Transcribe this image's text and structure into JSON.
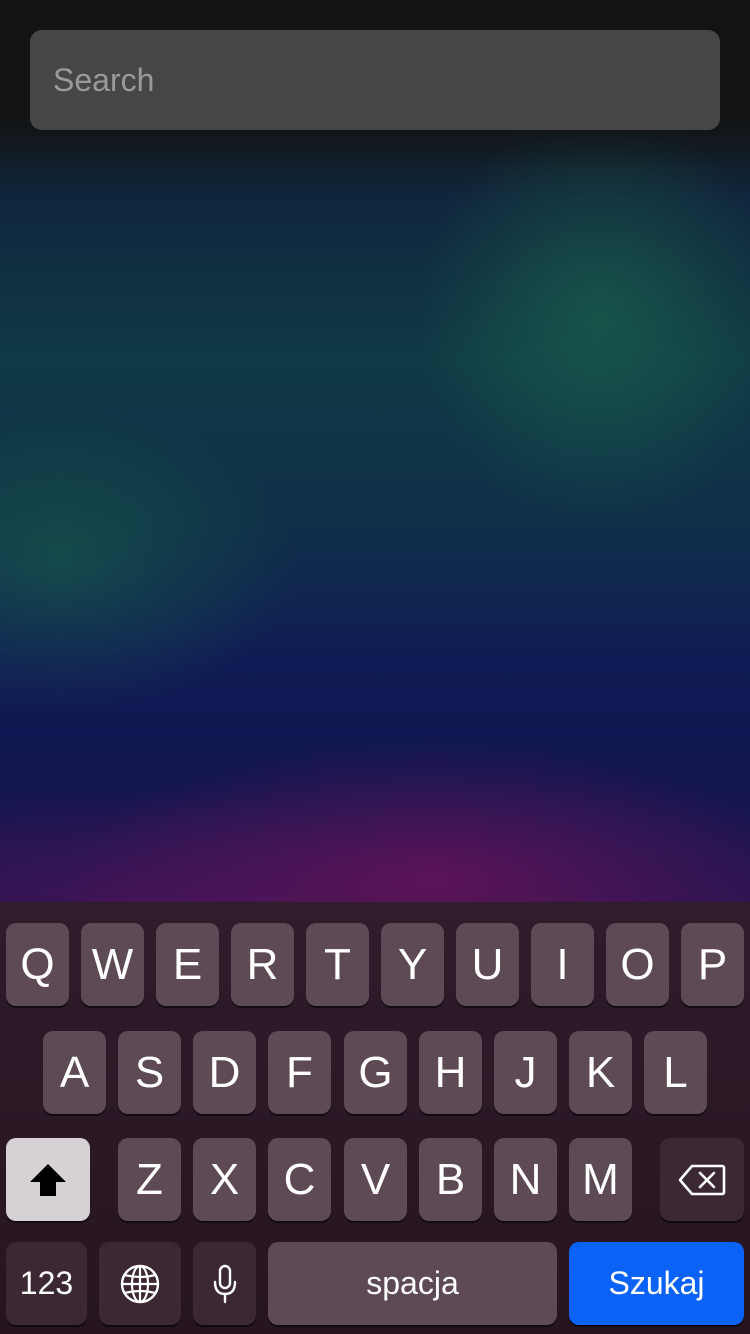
{
  "search": {
    "placeholder": "Search",
    "value": ""
  },
  "keyboard": {
    "row1": [
      "Q",
      "W",
      "E",
      "R",
      "T",
      "Y",
      "U",
      "I",
      "O",
      "P"
    ],
    "row2": [
      "A",
      "S",
      "D",
      "F",
      "G",
      "H",
      "J",
      "K",
      "L"
    ],
    "row3": [
      "Z",
      "X",
      "C",
      "V",
      "B",
      "N",
      "M"
    ],
    "numbers_label": "123",
    "space_label": "spacja",
    "search_label": "Szukaj",
    "icons": {
      "shift": "shift-arrow-icon",
      "delete": "backspace-icon",
      "globe": "globe-icon",
      "mic": "microphone-icon"
    }
  },
  "colors": {
    "key": "#5e4a55",
    "key_dark": "#3b2833",
    "shift_active": "#d6d1d4",
    "search_key": "#0b62f6"
  }
}
